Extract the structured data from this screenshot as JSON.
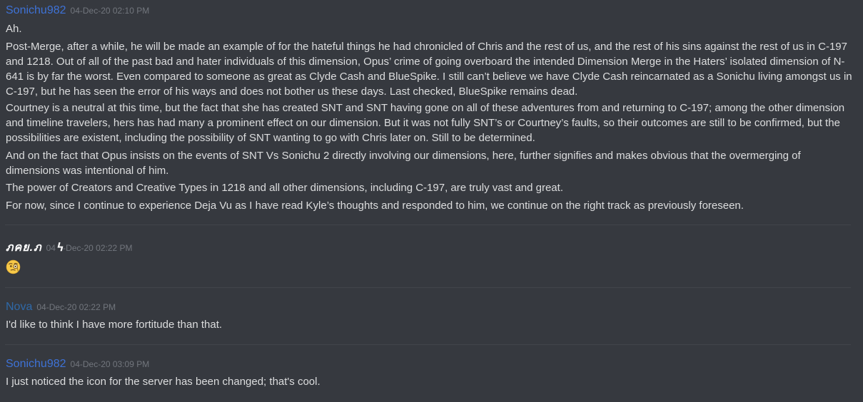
{
  "messages": [
    {
      "author": "Sonichu982",
      "timestamp": "04-Dec-20 02:10 PM",
      "paragraphs": [
        "Ah.",
        "Post-Merge, after a while, he will be made an example of for the hateful things he had chronicled of Chris and the rest of us, and the rest of his sins against the rest of us in C-197 and 1218.  Out of all of the past bad and hater individuals of this dimension, Opus’ crime of going overboard the intended Dimension Merge in the Haters’ isolated dimension of N-641 is by far the worst.  Even compared to someone as great as Clyde Cash and BlueSpike.  I still can’t believe we have Clyde Cash reincarnated as a Sonichu living amongst us in C-197, but he has seen the error of his ways and does not bother us these days.  Last checked, BlueSpike remains dead.",
        "Courtney is a neutral at this time, but the fact that she has created SNT and SNT having gone on all of these adventures from and returning to C-197; among the other dimension and timeline travelers, hers has had many a prominent effect on our dimension.  But it was not fully SNT’s or Courtney’s faults, so their outcomes are still to be confirmed, but the possibilities are existent, including the possibility of SNT wanting to go with Chris later on.  Still to be determined.",
        "And on the fact that Opus insists on the events of SNT Vs Sonichu 2 directly involving our dimensions, here, further signifies and makes obvious that the overmerging of dimensions was intentional of him.",
        "The power of Creators and Creative Types in 1218 and all other dimensions, including C-197, are truly vast and great.",
        "For now, since I continue to experience Deja Vu as I have read Kyle’s thoughts and responded to him, we continue on the right track as previously foreseen."
      ]
    },
    {
      "author": "ภคย.ภ߆",
      "timestamp": "04-Dec-20 02:22 PM",
      "emoji": "face-with-monocle-icon"
    },
    {
      "author": "Nova",
      "timestamp": "04-Dec-20 02:22 PM",
      "paragraphs": [
        "I'd like to think I have more fortitude than that."
      ]
    },
    {
      "author": "Sonichu982",
      "timestamp": "04-Dec-20 03:09 PM",
      "paragraphs": [
        "I just noticed the icon for the server has been changed; that's cool."
      ]
    }
  ],
  "colors": {
    "background": "#36393f",
    "text": "#dcddde",
    "timestamp": "#72767d",
    "sonichu982": "#3e72d6",
    "nova": "#2f69a8",
    "divider": "#42454a"
  }
}
